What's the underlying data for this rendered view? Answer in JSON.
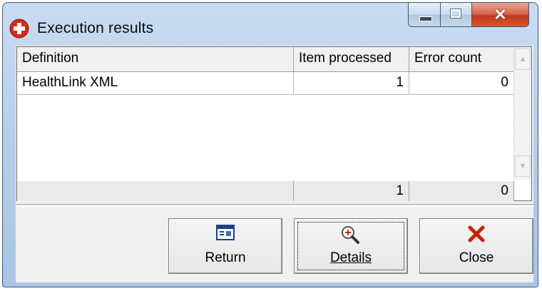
{
  "window": {
    "title": "Execution results",
    "app_icon": "red-circle-cross-icon",
    "caption_buttons": [
      "minimize",
      "maximize",
      "close"
    ]
  },
  "grid": {
    "columns": [
      "Definition",
      "Item processed",
      "Error count"
    ],
    "rows": [
      {
        "definition": "HealthLink XML",
        "items_processed": "1",
        "error_count": "0"
      }
    ],
    "totals": {
      "items_processed": "1",
      "error_count": "0"
    }
  },
  "buttons": {
    "return_label": "Return",
    "return_icon": "window-list-icon",
    "details_label": "Details",
    "details_icon": "magnifier-icon",
    "close_label": "Close",
    "close_icon": "red-x-icon"
  },
  "colors": {
    "title_bg": "#b7cfe9",
    "close_btn": "#c0381d",
    "close_icon": "#cc1f00"
  }
}
